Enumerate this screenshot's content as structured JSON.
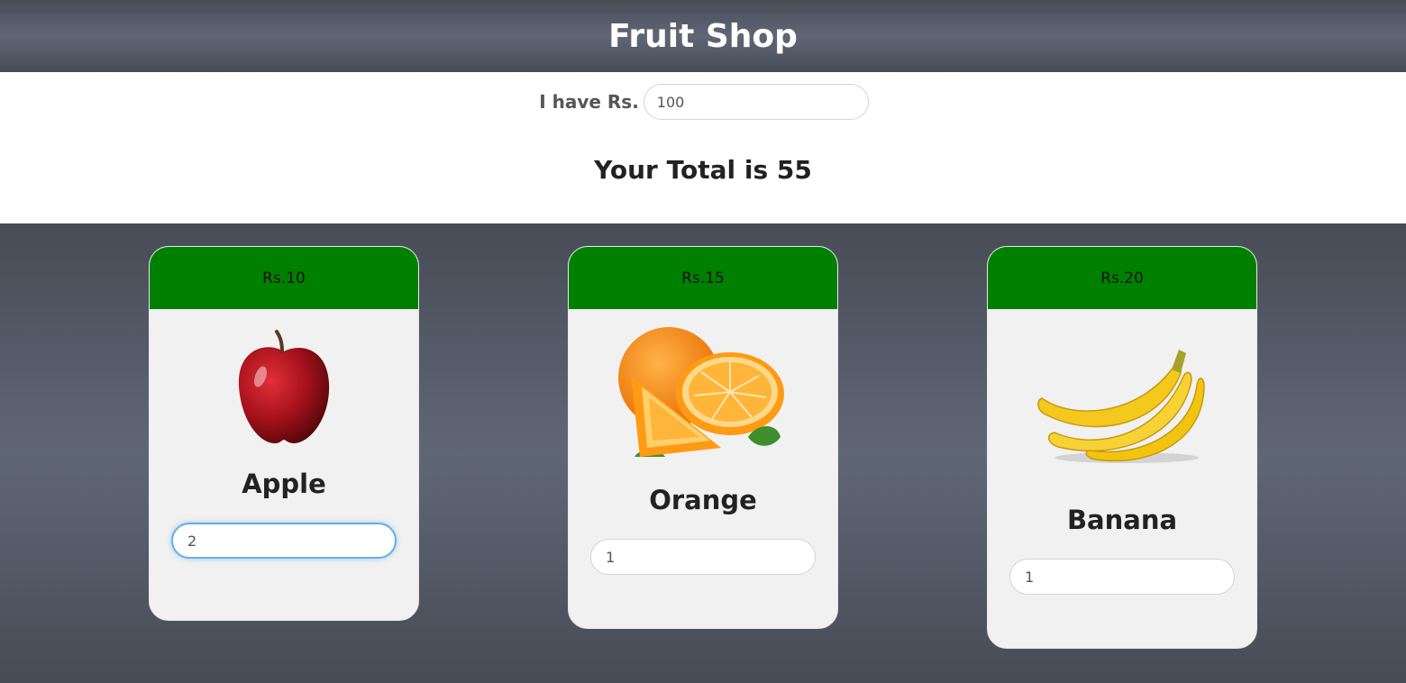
{
  "header": {
    "title": "Fruit Shop"
  },
  "budget": {
    "label": "I have Rs.",
    "value": "100"
  },
  "total": {
    "text": "Your Total is 55"
  },
  "fruits": [
    {
      "price": "Rs.10",
      "name": "Apple",
      "quantity": "2",
      "image_icon": "apple-icon"
    },
    {
      "price": "Rs.15",
      "name": "Orange",
      "quantity": "1",
      "image_icon": "orange-icon"
    },
    {
      "price": "Rs.20",
      "name": "Banana",
      "quantity": "1",
      "image_icon": "banana-icon"
    }
  ],
  "colors": {
    "header_bg": "#5f6676",
    "price_bar": "#008000",
    "card_bg": "#f1f1f1",
    "focus_ring": "#66afe9"
  }
}
